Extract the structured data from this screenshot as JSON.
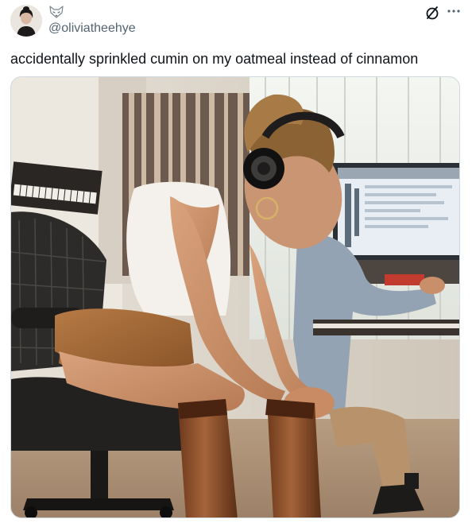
{
  "tweet": {
    "handle": "@oliviatheehye",
    "text": "accidentally sprinkled cumin on my oatmeal instead of cinnamon"
  },
  "icons": {
    "badge": "fox-icon",
    "grok": "grok-icon",
    "more": "more-icon"
  },
  "colors": {
    "text_primary": "#0f1419",
    "text_secondary": "#536471",
    "border": "#cfd9de"
  }
}
